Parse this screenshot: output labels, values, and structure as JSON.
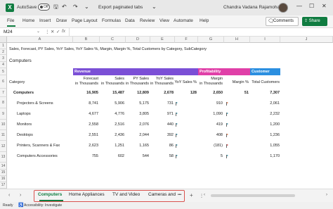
{
  "titlebar": {
    "app_icon": "X",
    "autosave_label": "AutoSave",
    "autosave_state": "Off",
    "doc_title": "Export paginated tabs",
    "user_name": "Chandra Vadana Rajamohan"
  },
  "ribbon": {
    "tabs": [
      "File",
      "Home",
      "Insert",
      "Draw",
      "Page Layout",
      "Formulas",
      "Data",
      "Review",
      "View",
      "Automate",
      "Help"
    ],
    "comments_label": "Comments",
    "share_label": "Share"
  },
  "formula_bar": {
    "name_box": "M24",
    "fx": "fx"
  },
  "columns": [
    "A",
    "B",
    "C",
    "D",
    "E",
    "F",
    "G",
    "H",
    "I",
    "J"
  ],
  "rows": [
    "1",
    "2",
    "3",
    "4",
    "5",
    "6",
    "7",
    "8",
    "9",
    "10",
    "11",
    "12",
    "13",
    "14",
    "15",
    "16",
    "17"
  ],
  "sheet": {
    "heading": "Sales, Forecast, PY Sales, YoY Sales, YoY Sales %, Margin, Margin %, Total Customers by Category, SubCategory",
    "group_title": "Computers",
    "bands": {
      "revenue": "Revenue",
      "profitability": "Profitability",
      "customer": "Customer"
    },
    "band_colors": {
      "revenue": "#7b4fd6",
      "profitability": "#e040a8",
      "customer": "#2b8fe0"
    },
    "headers": {
      "category": "Category",
      "forecast": [
        "Forecast",
        "in Thousands"
      ],
      "sales": [
        "Sales",
        "in Thousands"
      ],
      "py_sales": [
        "PY Sales",
        "in Thousands"
      ],
      "yoy": [
        "YoY Sales",
        "in Thousands"
      ],
      "yoy_pct": "YoY Sales %",
      "margin": [
        "Margin",
        "in Thousands"
      ],
      "margin_pct": "Margin %",
      "customers": "Total Customers"
    },
    "total": {
      "category": "Computers",
      "forecast": "16,905",
      "sales": "15,487",
      "py_sales": "12,809",
      "yoy": "2,678",
      "yoy_pct": "128",
      "margin": "2,650",
      "margin_pct": "51",
      "customers": "7,307"
    },
    "items": [
      {
        "category": "Projectors & Screens",
        "forecast": "8,741",
        "sales": "5,906",
        "py_sales": "5,175",
        "yoy": "731",
        "yoy_pct": "33",
        "margin": "910",
        "margin_pct": "4",
        "customers": "2,061"
      },
      {
        "category": "Laptops",
        "forecast": "4,677",
        "sales": "4,776",
        "py_sales": "3,805",
        "yoy": "971",
        "yoy_pct": "36",
        "margin": "1,090",
        "margin_pct": "15",
        "customers": "2,232"
      },
      {
        "category": "Monitors",
        "forecast": "2,558",
        "sales": "2,516",
        "py_sales": "2,076",
        "yoy": "440",
        "yoy_pct": "20",
        "margin": "419",
        "margin_pct": "15",
        "customers": "1,200"
      },
      {
        "category": "Desktops",
        "forecast": "2,551",
        "sales": "2,436",
        "py_sales": "2,044",
        "yoy": "392",
        "yoy_pct": "7",
        "margin": "408",
        "margin_pct": "9",
        "customers": "1,236"
      },
      {
        "category": "Printers, Scanners & Fax",
        "forecast": "2,623",
        "sales": "1,251",
        "py_sales": "1,165",
        "yoy": "86",
        "yoy_pct": "3",
        "margin": "(181)",
        "margin_pct": "(14)",
        "customers": "1,055"
      },
      {
        "category": "Computers Accessories",
        "forecast": "755",
        "sales": "602",
        "py_sales": "544",
        "yoy": "58",
        "yoy_pct": "2",
        "margin": "5",
        "margin_pct": "3",
        "customers": "1,170"
      }
    ],
    "flag_colors": {
      "yoy_pct": [
        "#2b8fa6",
        "#2b8fa6",
        "#2b8fa6",
        "#2b8fa6",
        "#2b8fa6",
        "#2b8fa6"
      ],
      "margin_pct": [
        "#e8703a",
        "#2b8fa6",
        "#2b8fa6",
        "#e8703a",
        "#d32f2f",
        "#2b8fa6"
      ]
    }
  },
  "sheet_tabs": {
    "tabs": [
      "Computers",
      "Home Appliances",
      "TV and Video",
      "Cameras and"
    ],
    "more": "•••",
    "add": "+"
  },
  "status": {
    "ready": "Ready",
    "accessibility": "Accessibility: Investigate"
  }
}
